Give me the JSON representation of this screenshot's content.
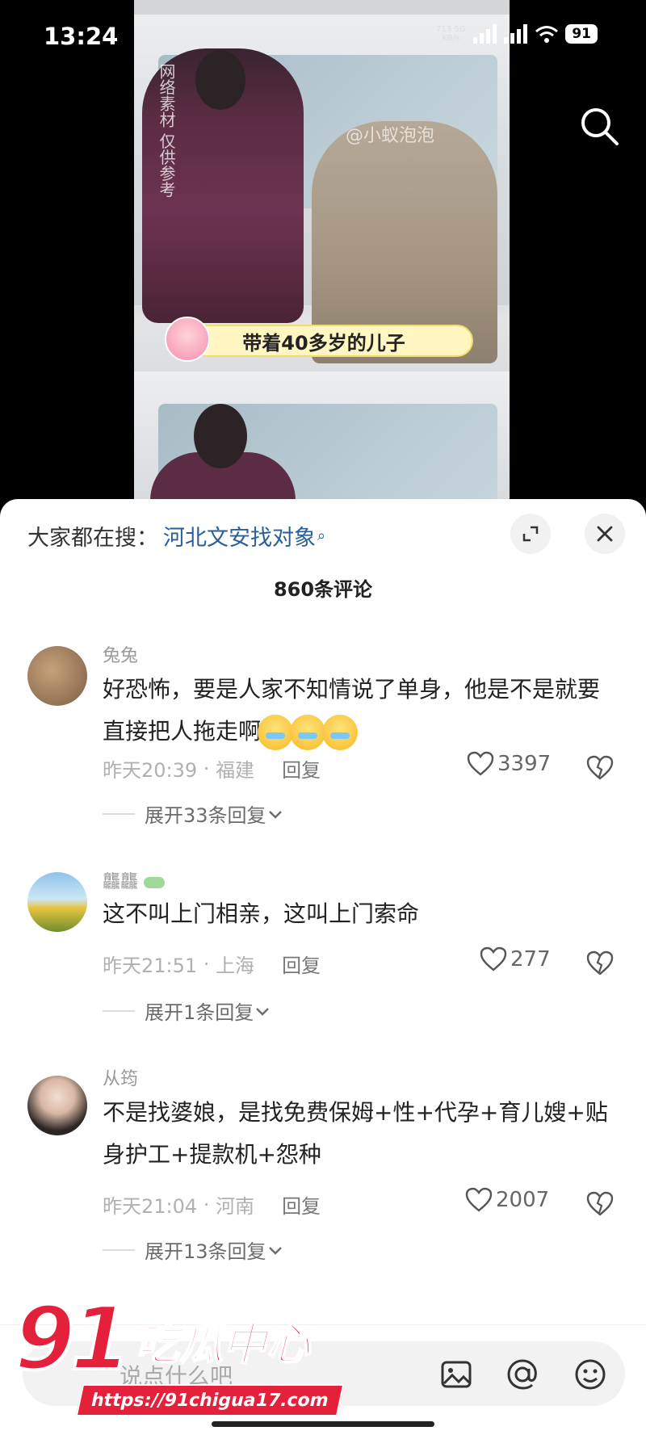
{
  "status_bar": {
    "time": "13:24",
    "net_speed_value": "713",
    "net_speed_unit": "KB/s",
    "network_type": "5G",
    "battery": "91"
  },
  "video": {
    "vertical_watermark": "网络素材 仅供参考",
    "handle_watermark": "@小蚁泡泡",
    "caption": "带着40多岁的儿子"
  },
  "sheet": {
    "search_prefix": "大家都在搜：",
    "search_term": "河北文安找对象",
    "comment_count": "860条评论"
  },
  "comments": [
    {
      "username": "兔兔",
      "text": "好恐怖，要是人家不知情说了单身，他是不是就要直接把人拖走啊",
      "time": "昨天20:39",
      "location": "福建",
      "reply_label": "回复",
      "likes": "3397",
      "expand_label": "展开33条回复"
    },
    {
      "username": "龘龘",
      "text": "这不叫上门相亲，这叫上门索命",
      "time": "昨天21:51",
      "location": "上海",
      "reply_label": "回复",
      "likes": "277",
      "expand_label": "展开1条回复"
    },
    {
      "username": "从筠",
      "text": "不是找婆娘，是找免费保姆+性+代孕+育儿嫂+贴身护工+提款机+怨种",
      "time": "昨天21:04",
      "location": "河南",
      "reply_label": "回复",
      "likes": "2007",
      "expand_label": "展开13条回复"
    }
  ],
  "bottom_bar": {
    "input_placeholder": "说点什么吧"
  },
  "site_watermark": {
    "logo_number": "91",
    "logo_text": "吃瓜中心",
    "url": "https://91chigua17.com"
  },
  "colors": {
    "accent_link": "#2b5f96",
    "watermark_red": "#e5203b"
  },
  "icons": [
    "search-icon",
    "expand-icon",
    "close-icon",
    "heart-icon",
    "dislike-icon",
    "chevron-down-icon",
    "image-icon",
    "at-icon",
    "emoji-icon"
  ]
}
